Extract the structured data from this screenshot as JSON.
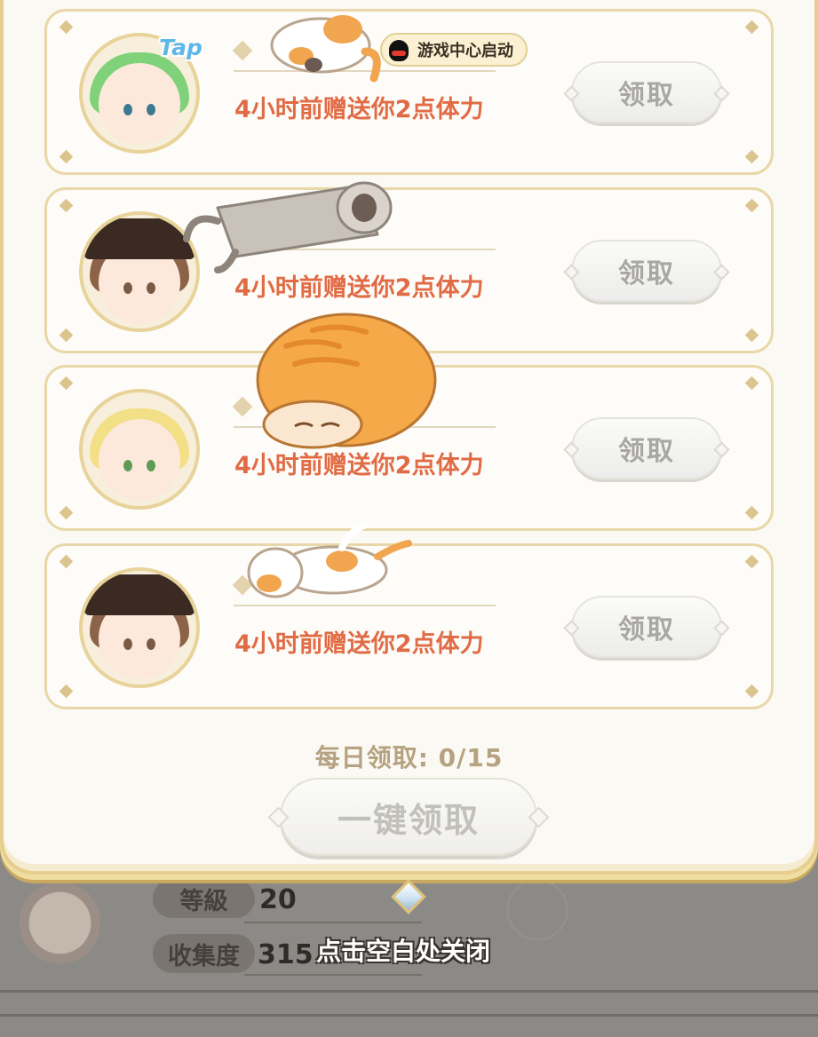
{
  "background_profile": {
    "level_label": "等級",
    "level_value": "20",
    "collection_label": "收集度",
    "collection_value": "315"
  },
  "friends": [
    {
      "avatar": "green-hair-girl",
      "badge": "Tap",
      "tag": "游戏中心启动",
      "gift_text": "4小时前赠送你2点体力",
      "claim_label": "领取"
    },
    {
      "avatar": "brown-hat-girl",
      "gift_text": "4小时前赠送你2点体力",
      "claim_label": "领取"
    },
    {
      "avatar": "blonde-girl",
      "gift_text": "4小时前赠送你2点体力",
      "claim_label": "领取"
    },
    {
      "avatar": "brown-hat-girl",
      "gift_text": "4小时前赠送你2点体力",
      "claim_label": "领取"
    }
  ],
  "daily_claim": {
    "text": "每日领取: 0/15",
    "claimed": 0,
    "limit": 15
  },
  "claim_all_label": "一键领取",
  "close_hint": "点击空白处关闭",
  "colors": {
    "gift_text": "#e06b45",
    "panel_border": "#e6cf8e",
    "button_text_disabled": "#a9a7a2"
  }
}
